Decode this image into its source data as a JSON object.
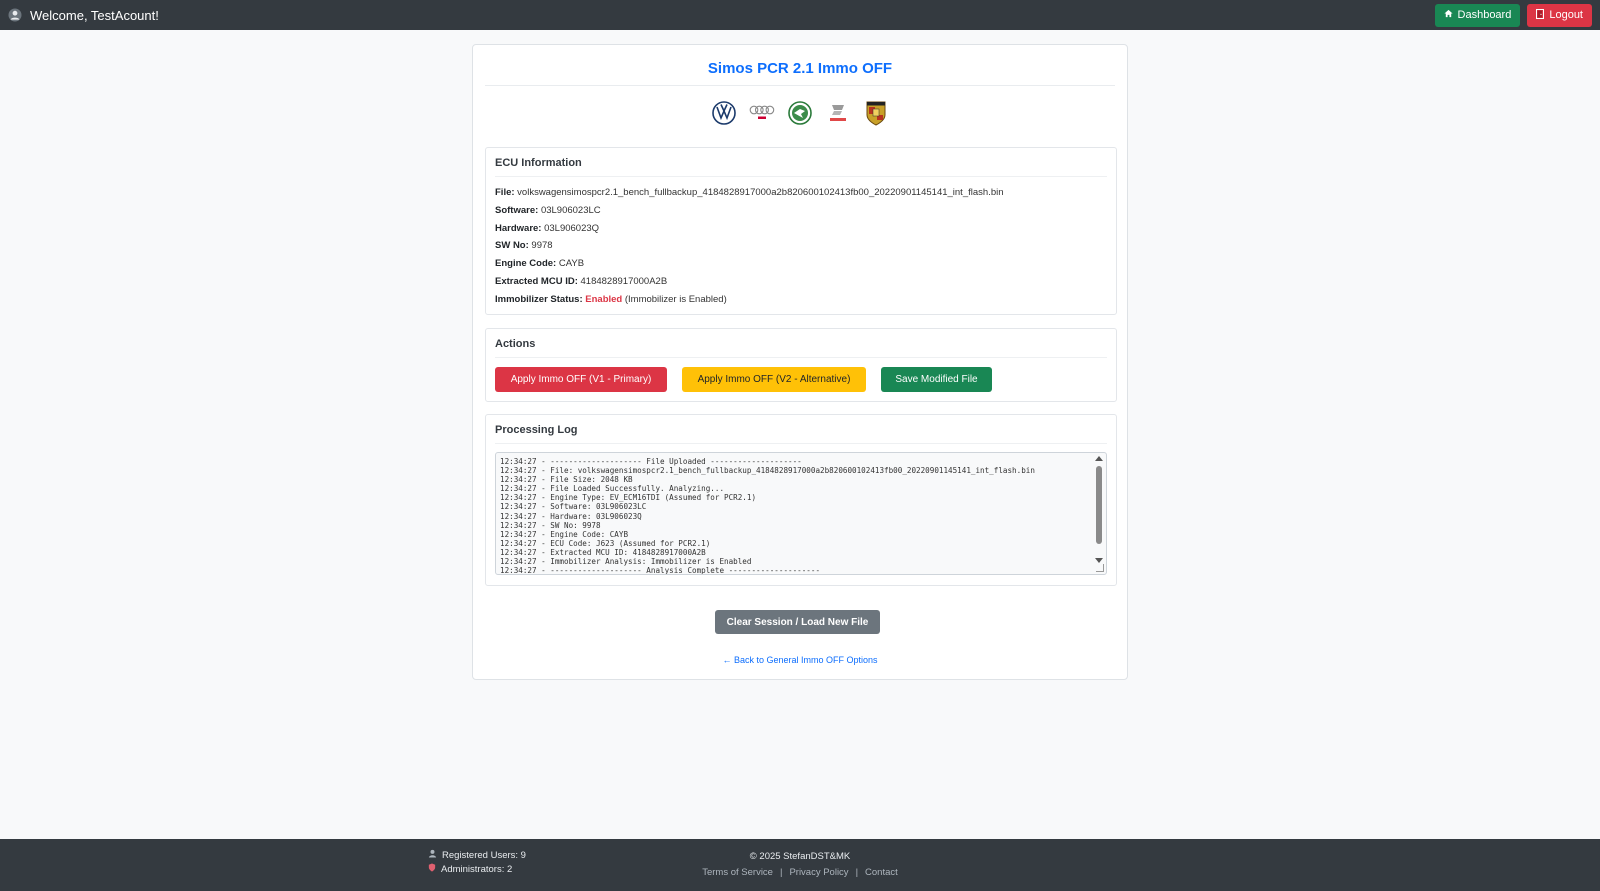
{
  "header": {
    "welcome": "Welcome, TestAcount!",
    "dashboard_label": "Dashboard",
    "logout_label": "Logout"
  },
  "card": {
    "title": "Simos PCR 2.1 Immo OFF",
    "brands": [
      "Volkswagen",
      "Audi",
      "Skoda",
      "Seat",
      "Porsche"
    ]
  },
  "ecu_info": {
    "heading": "ECU Information",
    "file_label": "File:",
    "file_value": "volkswagensimospcr2.1_bench_fullbackup_4184828917000a2b820600102413fb00_20220901145141_int_flash.bin",
    "software_label": "Software:",
    "software_value": "03L906023LC",
    "hardware_label": "Hardware:",
    "hardware_value": "03L906023Q",
    "swno_label": "SW No:",
    "swno_value": "9978",
    "engine_label": "Engine Code:",
    "engine_value": "CAYB",
    "mcu_label": "Extracted MCU ID:",
    "mcu_value": "4184828917000A2B",
    "immo_label": "Immobilizer Status:",
    "immo_status": "Enabled",
    "immo_note": "(Immobilizer is Enabled)"
  },
  "actions": {
    "heading": "Actions",
    "v1_label": "Apply Immo OFF (V1 - Primary)",
    "v2_label": "Apply Immo OFF (V2 - Alternative)",
    "save_label": "Save Modified File"
  },
  "log": {
    "heading": "Processing Log",
    "lines": [
      "12:34:27 - -------------------- File Uploaded --------------------",
      "12:34:27 - File: volkswagensimospcr2.1_bench_fullbackup_4184828917000a2b820600102413fb00_20220901145141_int_flash.bin",
      "12:34:27 - File Size: 2048 KB",
      "12:34:27 - File Loaded Successfully. Analyzing...",
      "12:34:27 - Engine Type: EV_ECM16TDI (Assumed for PCR2.1)",
      "12:34:27 - Software: 03L906023LC",
      "12:34:27 - Hardware: 03L906023Q",
      "12:34:27 - SW No: 9978",
      "12:34:27 - Engine Code: CAYB",
      "12:34:27 - ECU Code: J623 (Assumed for PCR2.1)",
      "12:34:27 - Extracted MCU ID: 4184828917000A2B",
      "12:34:27 - Immobilizer Analysis: Immobilizer is Enabled",
      "12:34:27 - -------------------- Analysis Complete --------------------"
    ]
  },
  "clear_label": "Clear Session / Load New File",
  "back_link": "← Back to General Immo OFF Options",
  "footer": {
    "registered_users": "Registered Users: 9",
    "administrators": "Administrators: 2",
    "copyright": "© 2025 StefanDST&MK",
    "terms": "Terms of Service",
    "privacy": "Privacy Policy",
    "contact": "Contact",
    "separator": "|"
  },
  "colors": {
    "navbar": "#343a40",
    "primary": "#0d6efd",
    "danger": "#dc3545",
    "warning": "#ffc107",
    "success": "#198754",
    "secondary": "#6c757d"
  }
}
